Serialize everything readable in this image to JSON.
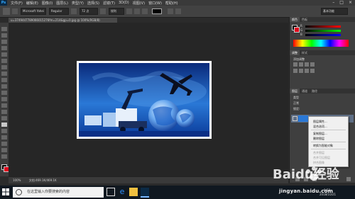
{
  "app": {
    "logo": "Ps",
    "menus": [
      "文件(F)",
      "编辑(E)",
      "图像(I)",
      "图层(L)",
      "类型(Y)",
      "选择(S)",
      "滤镜(T)",
      "3D(D)",
      "视图(V)",
      "窗口(W)",
      "帮助(H)"
    ],
    "window_controls": [
      "–",
      "□",
      "×"
    ]
  },
  "options": {
    "font_family": "Microsoft Yahei",
    "font_style": "Regular",
    "font_size": "72 点",
    "anti_alias": "锐利",
    "workspace": "基本功能"
  },
  "document": {
    "tab_title": "u=3749447789066015276fm=214&gp=0.jpg @ 100%(RGB/8)"
  },
  "statusbar": {
    "zoom": "100%",
    "doc_size": "文档:469.1K/469.1K"
  },
  "panels": {
    "color_tabs": [
      "颜色",
      "色板"
    ],
    "slider_labels": [
      "R",
      "G",
      "B"
    ],
    "adjust_tabs": [
      "调整",
      "样式"
    ],
    "adjust_title": "添加调整",
    "layer_tabs": [
      "图层",
      "通道",
      "路径"
    ],
    "layer_kind": "类型",
    "layer_mode": "正常",
    "layer_lock": "锁定:"
  },
  "context_menu": {
    "items": [
      {
        "label": "图层属性...",
        "enabled": true
      },
      {
        "label": "混合选项...",
        "enabled": true
      },
      {
        "label": "复制图层...",
        "enabled": true
      },
      {
        "label": "删除图层",
        "enabled": true
      },
      {
        "label": "转换为智能对象",
        "enabled": true
      },
      {
        "label": "合并图层",
        "enabled": false
      },
      {
        "label": "合并可见图层",
        "enabled": false
      },
      {
        "label": "拼合图像",
        "enabled": false
      }
    ]
  },
  "taskbar": {
    "search_placeholder": "在这里输入你要搜索的内容",
    "time": "8:52",
    "date": "2018/10/21"
  },
  "watermark": {
    "brand": "Baidu经验",
    "url": "jingyan.baidu.com"
  },
  "colors": {
    "foreground": "#000000",
    "background": "#e0001b",
    "accent": "#31a8ff"
  }
}
